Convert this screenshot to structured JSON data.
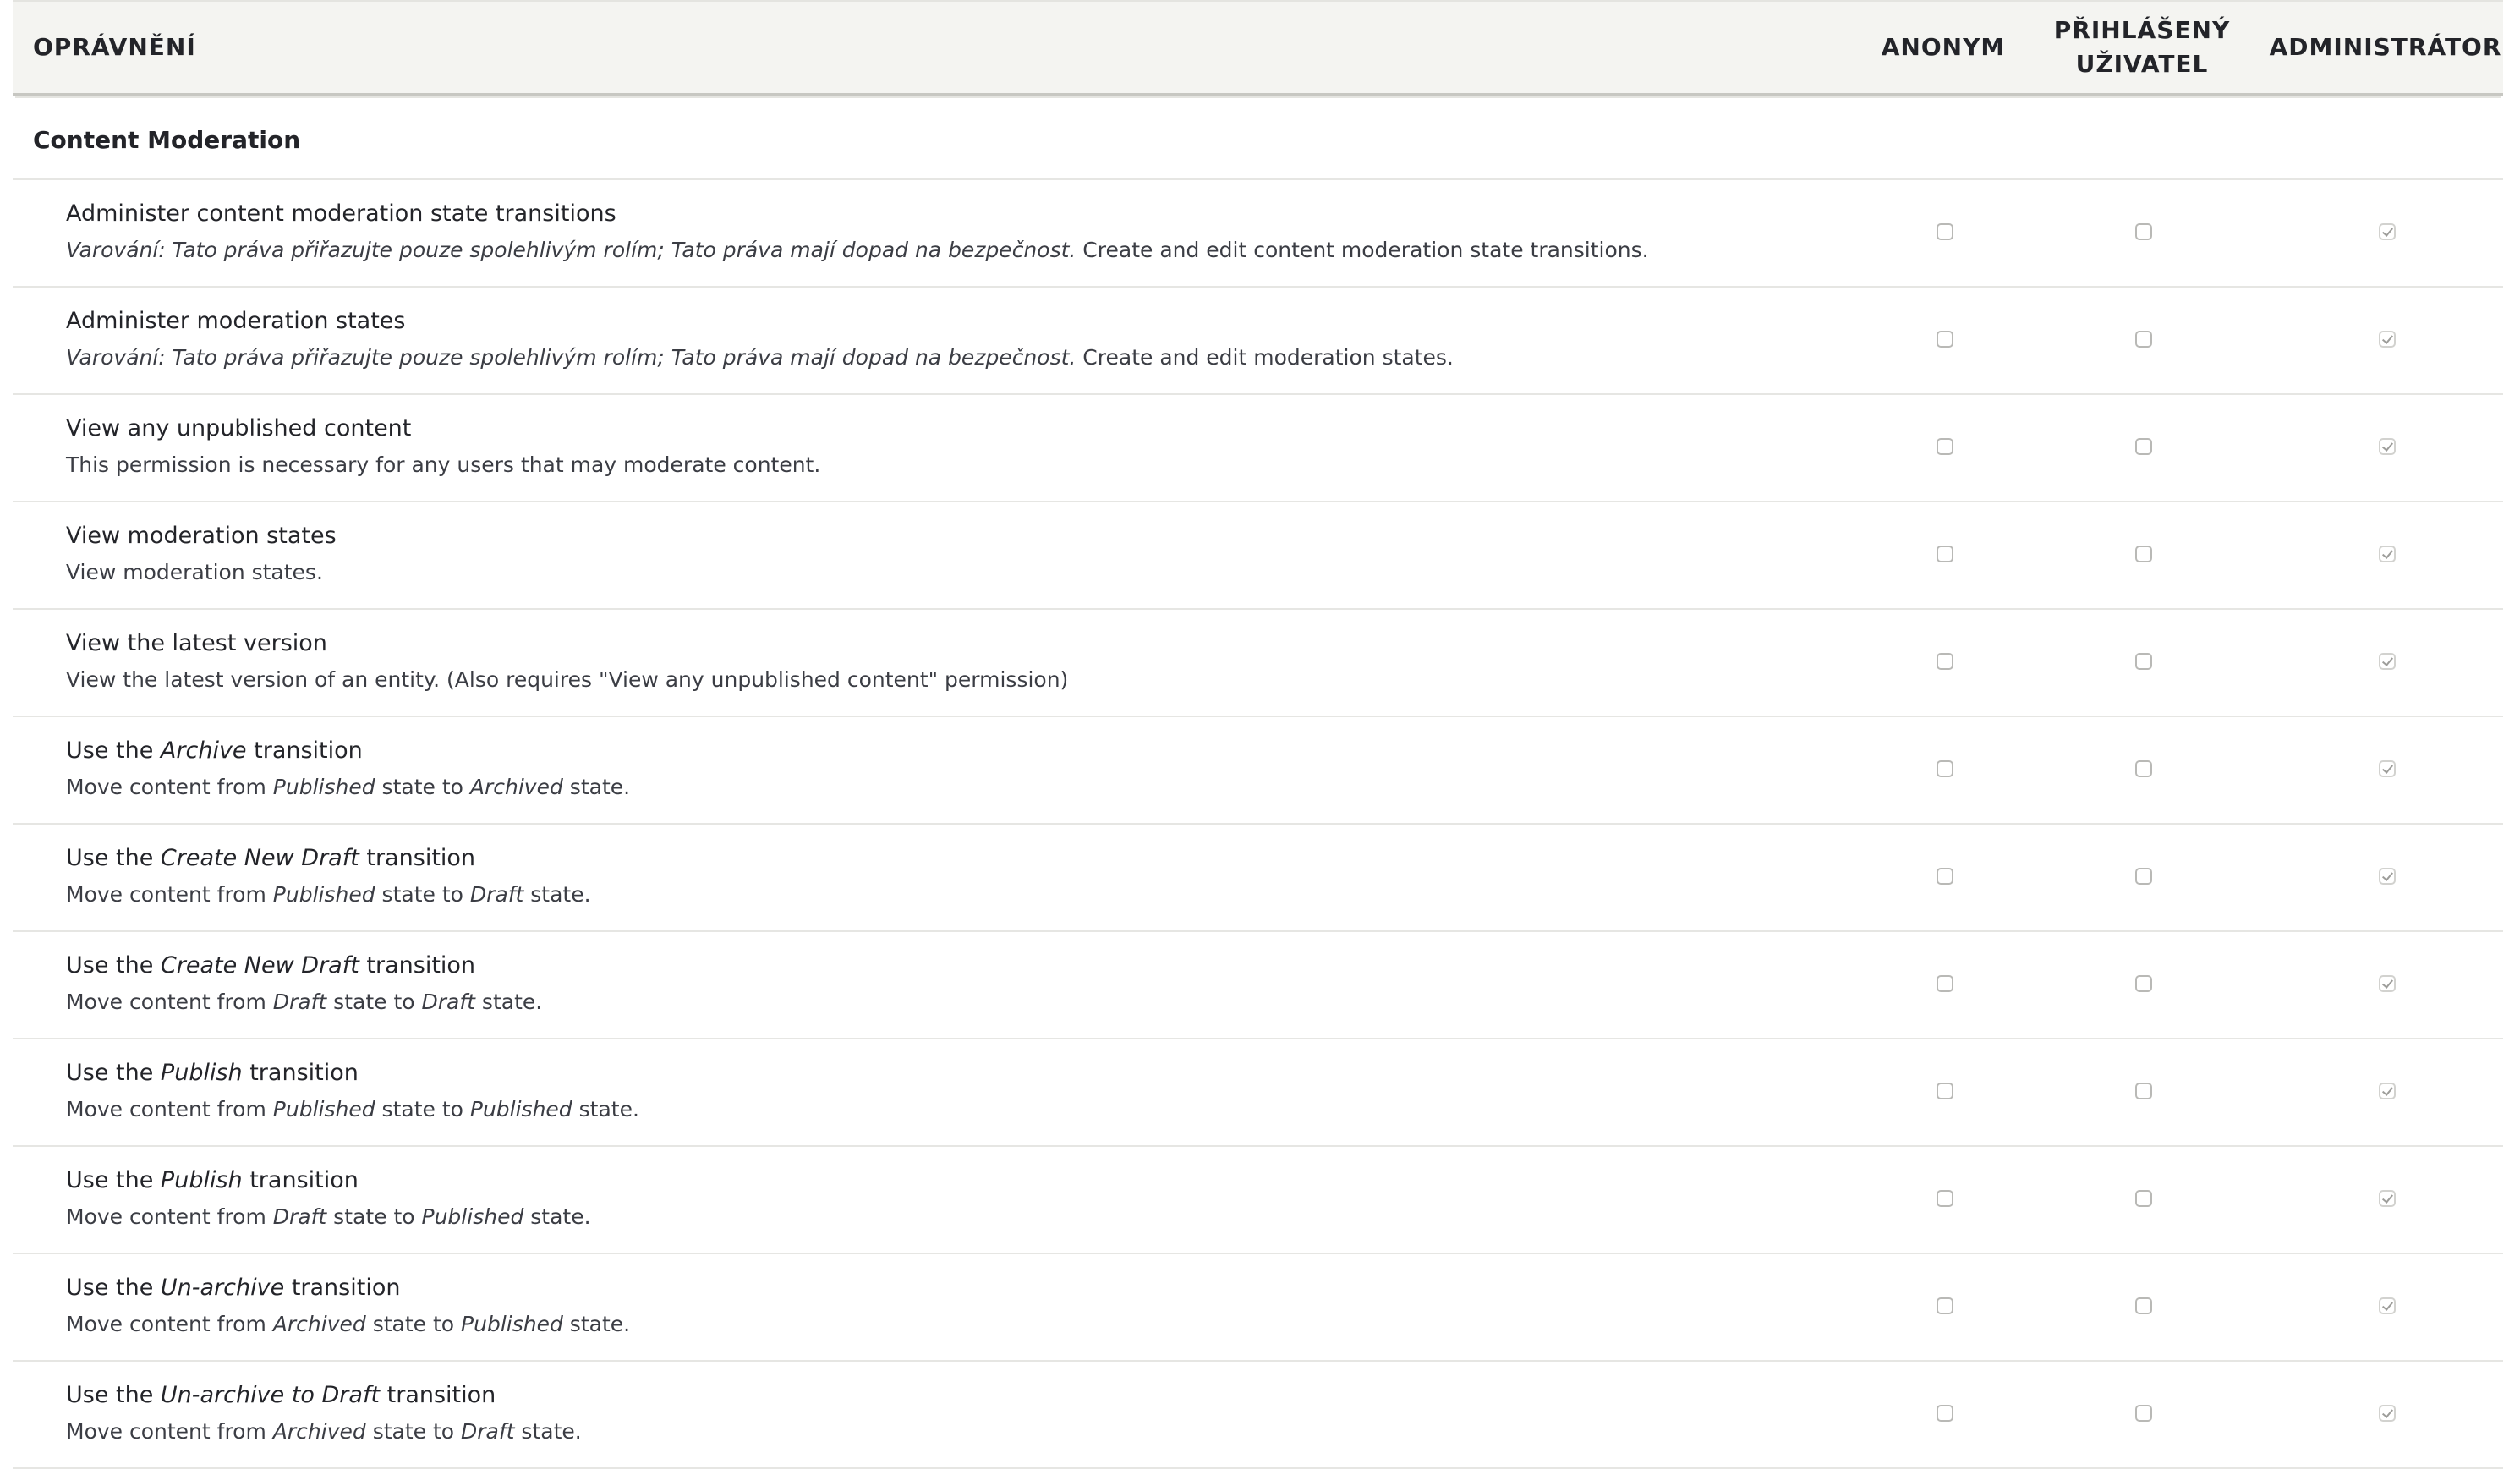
{
  "header": {
    "permission": "OPRÁVNĚNÍ",
    "roles": [
      {
        "label": "ANONYM"
      },
      {
        "label": "PŘIHLÁŠENÝ\nUŽIVATEL"
      },
      {
        "label": "ADMINISTRÁTOR"
      }
    ]
  },
  "group": {
    "label": "Content Moderation"
  },
  "rows": [
    {
      "title": [
        {
          "t": "Administer content moderation state transitions"
        }
      ],
      "desc": [
        {
          "t": "Varování: Tato práva přiřazujte pouze spolehlivým rolím; Tato práva mají dopad na bezpečnost.",
          "i": true
        },
        {
          "t": " Create and edit content moderation state transitions."
        }
      ],
      "anon": false,
      "auth": false,
      "admin": true
    },
    {
      "title": [
        {
          "t": "Administer moderation states"
        }
      ],
      "desc": [
        {
          "t": "Varování: Tato práva přiřazujte pouze spolehlivým rolím; Tato práva mají dopad na bezpečnost.",
          "i": true
        },
        {
          "t": " Create and edit moderation states."
        }
      ],
      "anon": false,
      "auth": false,
      "admin": true
    },
    {
      "title": [
        {
          "t": "View any unpublished content"
        }
      ],
      "desc": [
        {
          "t": "This permission is necessary for any users that may moderate content."
        }
      ],
      "anon": false,
      "auth": false,
      "admin": true
    },
    {
      "title": [
        {
          "t": "View moderation states"
        }
      ],
      "desc": [
        {
          "t": "View moderation states."
        }
      ],
      "anon": false,
      "auth": false,
      "admin": true
    },
    {
      "title": [
        {
          "t": "View the latest version"
        }
      ],
      "desc": [
        {
          "t": "View the latest version of an entity. (Also requires \"View any unpublished content\" permission)"
        }
      ],
      "anon": false,
      "auth": false,
      "admin": true
    },
    {
      "title": [
        {
          "t": "Use the "
        },
        {
          "t": "Archive",
          "i": true
        },
        {
          "t": " transition"
        }
      ],
      "desc": [
        {
          "t": "Move content from "
        },
        {
          "t": "Published",
          "i": true
        },
        {
          "t": " state to "
        },
        {
          "t": "Archived",
          "i": true
        },
        {
          "t": " state."
        }
      ],
      "anon": false,
      "auth": false,
      "admin": true
    },
    {
      "title": [
        {
          "t": "Use the "
        },
        {
          "t": "Create New Draft",
          "i": true
        },
        {
          "t": " transition"
        }
      ],
      "desc": [
        {
          "t": "Move content from "
        },
        {
          "t": "Published",
          "i": true
        },
        {
          "t": " state to "
        },
        {
          "t": "Draft",
          "i": true
        },
        {
          "t": " state."
        }
      ],
      "anon": false,
      "auth": false,
      "admin": true
    },
    {
      "title": [
        {
          "t": "Use the "
        },
        {
          "t": "Create New Draft",
          "i": true
        },
        {
          "t": " transition"
        }
      ],
      "desc": [
        {
          "t": "Move content from "
        },
        {
          "t": "Draft",
          "i": true
        },
        {
          "t": " state to "
        },
        {
          "t": "Draft",
          "i": true
        },
        {
          "t": " state."
        }
      ],
      "anon": false,
      "auth": false,
      "admin": true
    },
    {
      "title": [
        {
          "t": "Use the "
        },
        {
          "t": "Publish",
          "i": true
        },
        {
          "t": " transition"
        }
      ],
      "desc": [
        {
          "t": "Move content from "
        },
        {
          "t": "Published",
          "i": true
        },
        {
          "t": " state to "
        },
        {
          "t": "Published",
          "i": true
        },
        {
          "t": " state."
        }
      ],
      "anon": false,
      "auth": false,
      "admin": true
    },
    {
      "title": [
        {
          "t": "Use the "
        },
        {
          "t": "Publish",
          "i": true
        },
        {
          "t": " transition"
        }
      ],
      "desc": [
        {
          "t": "Move content from "
        },
        {
          "t": "Draft",
          "i": true
        },
        {
          "t": " state to "
        },
        {
          "t": "Published",
          "i": true
        },
        {
          "t": " state."
        }
      ],
      "anon": false,
      "auth": false,
      "admin": true
    },
    {
      "title": [
        {
          "t": "Use the "
        },
        {
          "t": "Un-archive",
          "i": true
        },
        {
          "t": " transition"
        }
      ],
      "desc": [
        {
          "t": "Move content from "
        },
        {
          "t": "Archived",
          "i": true
        },
        {
          "t": " state to "
        },
        {
          "t": "Published",
          "i": true
        },
        {
          "t": " state."
        }
      ],
      "anon": false,
      "auth": false,
      "admin": true
    },
    {
      "title": [
        {
          "t": "Use the "
        },
        {
          "t": "Un-archive to Draft",
          "i": true
        },
        {
          "t": " transition"
        }
      ],
      "desc": [
        {
          "t": "Move content from "
        },
        {
          "t": "Archived",
          "i": true
        },
        {
          "t": " state to "
        },
        {
          "t": "Draft",
          "i": true
        },
        {
          "t": " state."
        }
      ],
      "anon": false,
      "auth": false,
      "admin": true
    }
  ]
}
